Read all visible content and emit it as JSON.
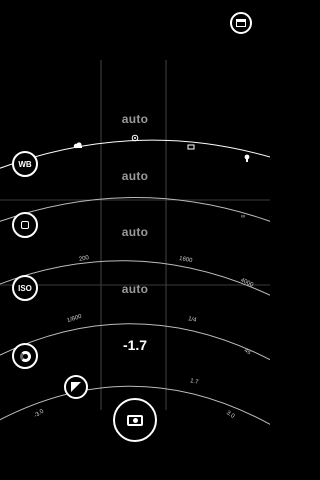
{
  "controls": {
    "white_balance": {
      "label": "WB",
      "value": "auto"
    },
    "focus": {
      "value": "auto"
    },
    "iso": {
      "label": "ISO",
      "value": "auto"
    },
    "shutter": {
      "value": "auto"
    },
    "exposure": {
      "value": "-1.7"
    }
  },
  "scales": {
    "iso_ticks": [
      "200",
      "1600",
      "4000"
    ],
    "shutter_ticks": [
      "1/800",
      "1/4",
      "4s"
    ],
    "exposure_ticks": [
      "-3.0",
      "1.7",
      "3.0"
    ],
    "focus_infinity": "∞",
    "wb_presets": [
      "cloudy-icon",
      "auto-icon",
      "fluorescent-icon",
      "incandescent-icon"
    ]
  },
  "colors": {
    "background": "#000000",
    "foreground": "#ffffff",
    "muted": "#9a9a9a",
    "guide": "#555555"
  }
}
